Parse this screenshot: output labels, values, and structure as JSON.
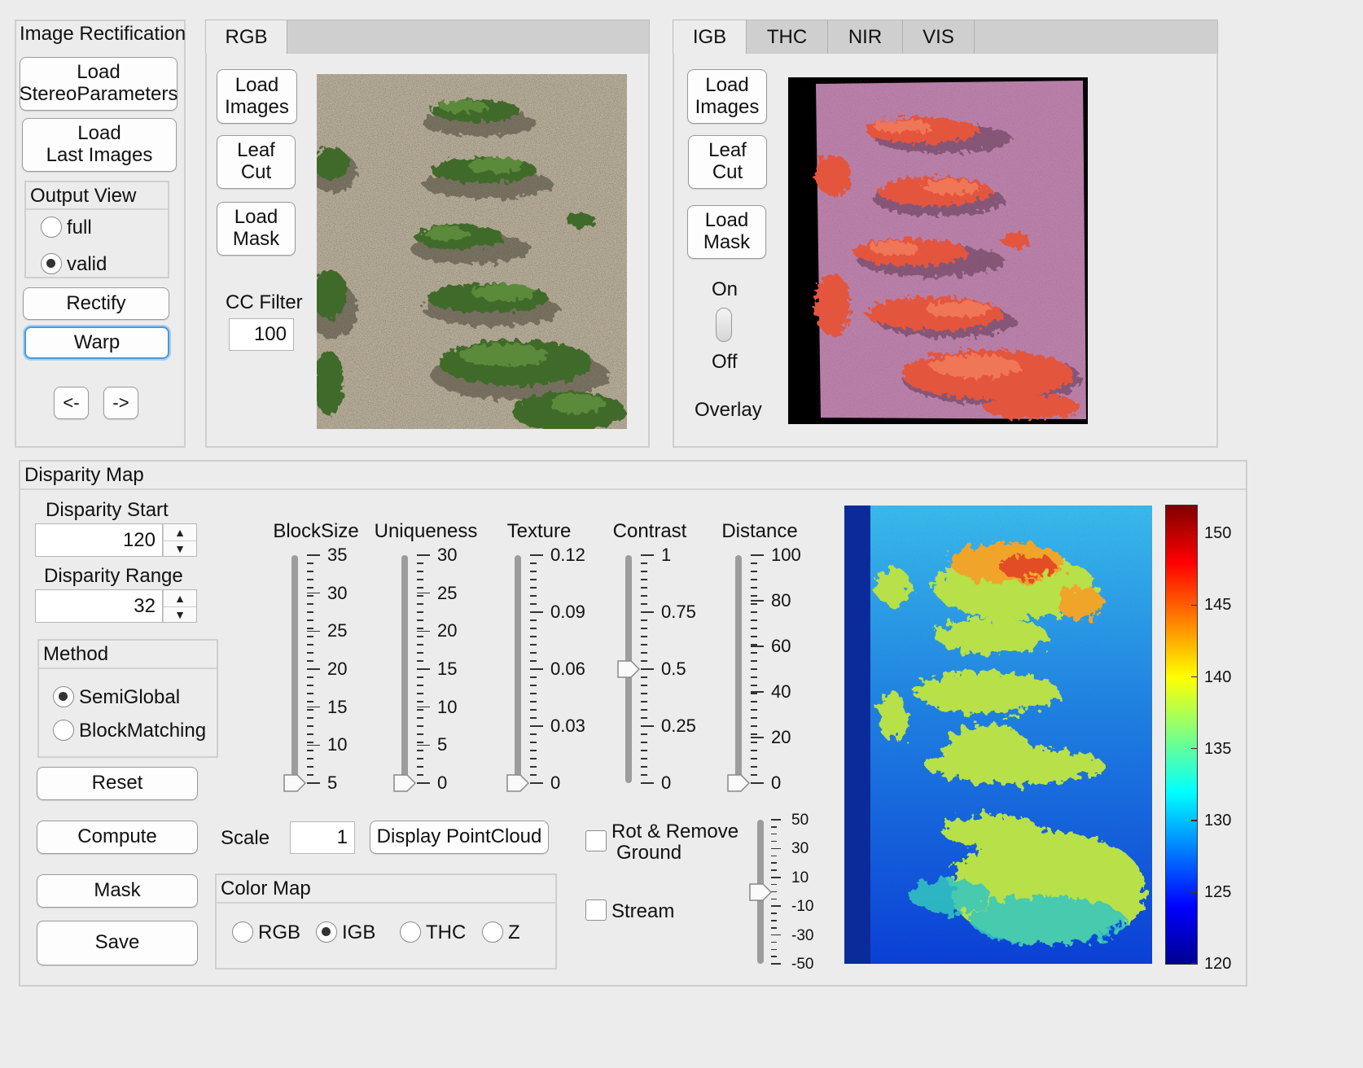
{
  "rectification": {
    "title": "Image Rectification",
    "load_stereo": [
      "Load",
      "StereoParameters"
    ],
    "load_last": [
      "Load",
      "Last Images"
    ],
    "output_view": {
      "title": "Output View",
      "options": [
        "full",
        "valid"
      ],
      "selected": "valid"
    },
    "rectify": "Rectify",
    "warp": "Warp",
    "prev": "<-",
    "next": "->"
  },
  "rgb_panel": {
    "tabs": [
      "RGB"
    ],
    "active_tab": "RGB",
    "load_images": [
      "Load",
      "Images"
    ],
    "leaf_cut": [
      "Leaf",
      "Cut"
    ],
    "load_mask": [
      "Load",
      "Mask"
    ],
    "cc_filter_label": "CC Filter",
    "cc_filter_value": "100"
  },
  "igb_panel": {
    "tabs": [
      "IGB",
      "THC",
      "NIR",
      "VIS"
    ],
    "active_tab": "IGB",
    "load_images": [
      "Load",
      "Images"
    ],
    "leaf_cut": [
      "Leaf",
      "Cut"
    ],
    "load_mask": [
      "Load",
      "Mask"
    ],
    "toggle_on": "On",
    "toggle_off": "Off",
    "overlay": "Overlay"
  },
  "disparity": {
    "title": "Disparity Map",
    "start_label": "Disparity Start",
    "start_value": "120",
    "range_label": "Disparity Range",
    "range_value": "32",
    "method": {
      "title": "Method",
      "options": [
        "SemiGlobal",
        "BlockMatching"
      ],
      "selected": "SemiGlobal"
    },
    "reset": "Reset",
    "compute": "Compute",
    "mask": "Mask",
    "save": "Save",
    "scale_label": "Scale",
    "scale_value": "1",
    "display_pointcloud": "Display PointCloud",
    "colormap": {
      "title": "Color Map",
      "options": [
        "RGB",
        "IGB",
        "THC",
        "Z"
      ],
      "selected": "IGB"
    },
    "rot_remove": [
      "Rot & Remove",
      "Ground"
    ],
    "stream": "Stream",
    "sliders": [
      {
        "name": "BlockSize",
        "ticks": [
          "35",
          "30",
          "25",
          "20",
          "15",
          "10",
          "5"
        ],
        "value": 5,
        "min": 5,
        "max": 35
      },
      {
        "name": "Uniqueness",
        "ticks": [
          "30",
          "25",
          "20",
          "15",
          "10",
          "5",
          "0"
        ],
        "value": 0,
        "min": 0,
        "max": 30
      },
      {
        "name": "Texture",
        "ticks": [
          "0.12",
          "0.09",
          "0.06",
          "0.03",
          "0"
        ],
        "value": 0,
        "min": 0,
        "max": 0.12
      },
      {
        "name": "Contrast",
        "ticks": [
          "1",
          "0.75",
          "0.5",
          "0.25",
          "0"
        ],
        "value": 0.5,
        "min": 0,
        "max": 1
      },
      {
        "name": "Distance",
        "ticks": [
          "100",
          "80",
          "60",
          "40",
          "20",
          "0"
        ],
        "value": 0,
        "min": 0,
        "max": 100
      }
    ],
    "rot_slider": {
      "ticks": [
        "50",
        "30",
        "10",
        "-10",
        "-30",
        "-50"
      ],
      "value": 0,
      "min": -50,
      "max": 50
    },
    "colorbar": {
      "ticks": [
        "150",
        "145",
        "140",
        "135",
        "130",
        "125",
        "120"
      ],
      "min": 120,
      "max": 152
    }
  }
}
